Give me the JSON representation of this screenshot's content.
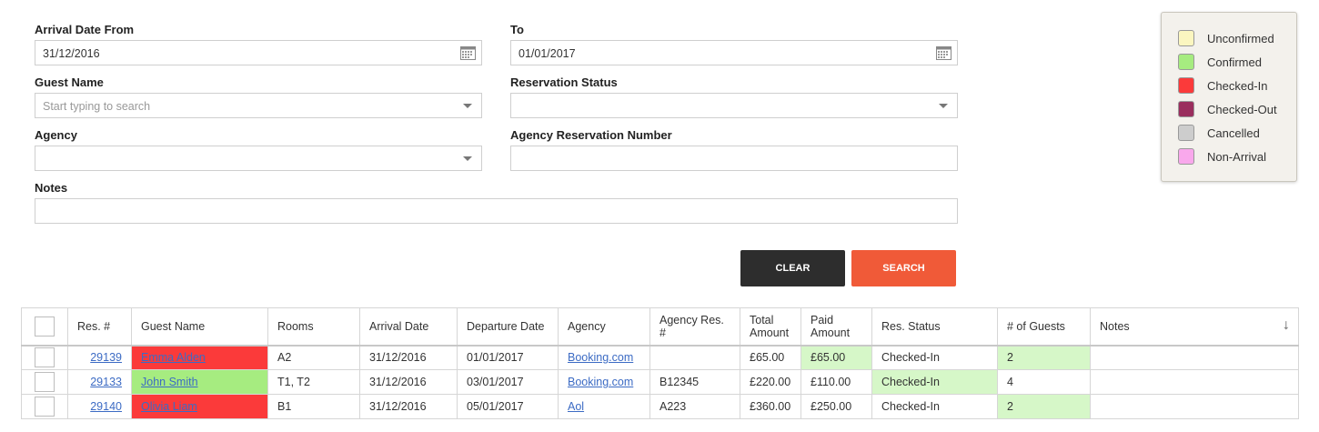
{
  "filters": {
    "arrival_from_label": "Arrival Date From",
    "arrival_from_value": "31/12/2016",
    "to_label": "To",
    "to_value": "01/01/2017",
    "guest_name_label": "Guest Name",
    "guest_name_placeholder": "Start typing to search",
    "reservation_status_label": "Reservation Status",
    "reservation_status_value": "",
    "agency_label": "Agency",
    "agency_value": "",
    "agency_res_number_label": "Agency Reservation Number",
    "agency_res_number_value": "",
    "notes_label": "Notes",
    "notes_value": ""
  },
  "buttons": {
    "clear_label": "CLEAR",
    "search_label": "SEARCH",
    "clear_color": "#2d2d2d",
    "search_color": "#f05a38"
  },
  "legend": {
    "items": [
      {
        "label": "Unconfirmed",
        "color": "#fbf6c0"
      },
      {
        "label": "Confirmed",
        "color": "#a6ec80"
      },
      {
        "label": "Checked-In",
        "color": "#fb3a3a"
      },
      {
        "label": "Checked-Out",
        "color": "#9a2e5e"
      },
      {
        "label": "Cancelled",
        "color": "#cdcdcd"
      },
      {
        "label": "Non-Arrival",
        "color": "#f9a8ec"
      }
    ]
  },
  "table": {
    "headers": {
      "res_no": "Res. #",
      "guest_name": "Guest Name",
      "rooms": "Rooms",
      "arrival": "Arrival Date",
      "departure": "Departure Date",
      "agency": "Agency",
      "agency_res": "Agency Res. #",
      "total": "Total Amount",
      "paid": "Paid Amount",
      "status": "Res. Status",
      "guests": "# of Guests",
      "notes": "Notes"
    },
    "rows": [
      {
        "res_no": "29139",
        "guest_name": "Emma Alden",
        "rooms": "A2",
        "arrival": "31/12/2016",
        "departure": "01/01/2017",
        "agency": "Booking.com",
        "agency_res": "",
        "total": "£65.00",
        "paid": "£65.00",
        "status": "Checked-In",
        "guests": "2",
        "notes": ""
      },
      {
        "res_no": "29133",
        "guest_name": "John Smith",
        "rooms": "T1, T2",
        "arrival": "31/12/2016",
        "departure": "03/01/2017",
        "agency": "Booking.com",
        "agency_res": "B12345",
        "total": "£220.00",
        "paid": "£110.00",
        "status": "Checked-In",
        "guests": "4",
        "notes": ""
      },
      {
        "res_no": "29140",
        "guest_name": "Olivia Liam",
        "rooms": "B1",
        "arrival": "31/12/2016",
        "departure": "05/01/2017",
        "agency": "Aol",
        "agency_res": "A223",
        "total": "£360.00",
        "paid": "£250.00",
        "status": "Checked-In",
        "guests": "2",
        "notes": ""
      }
    ]
  }
}
